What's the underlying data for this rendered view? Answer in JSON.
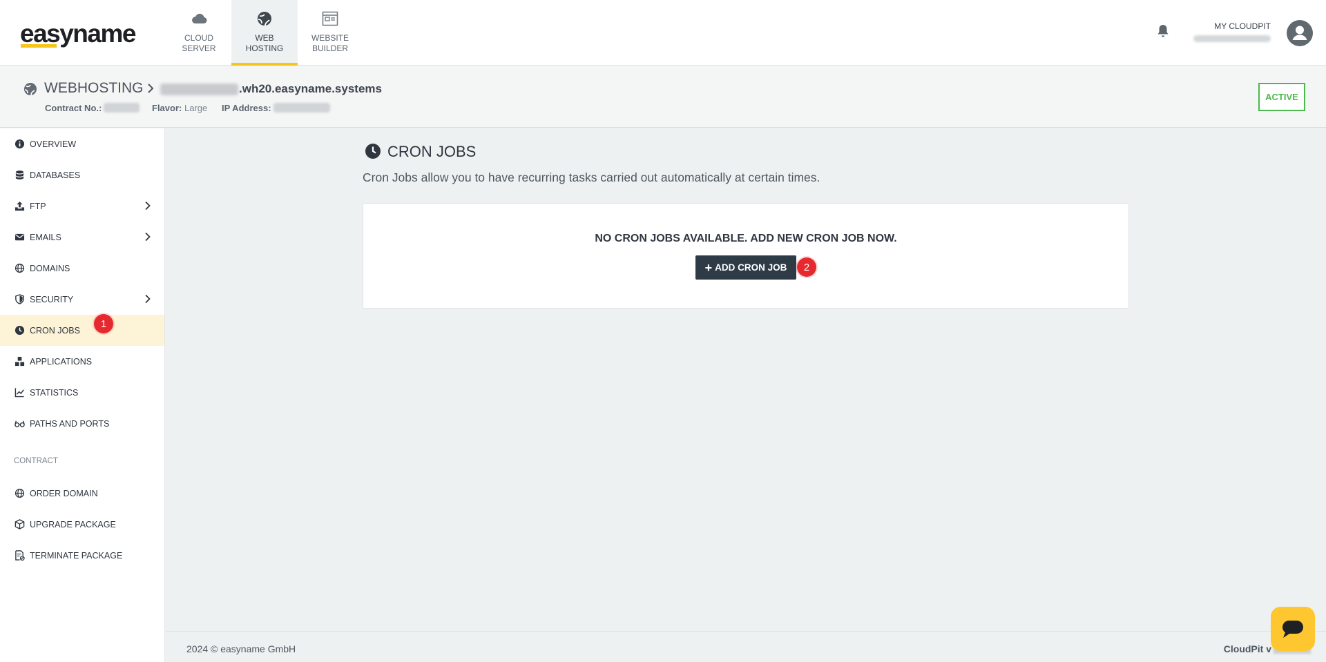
{
  "brand": {
    "logo_text": "easyname",
    "accent": "#f5c518"
  },
  "topnav": {
    "items": [
      {
        "line1": "CLOUD",
        "line2": "SERVER",
        "icon": "cloud-icon"
      },
      {
        "line1": "WEB",
        "line2": "HOSTING",
        "icon": "globe-icon",
        "active": true
      },
      {
        "line1": "WEBSITE",
        "line2": "BUILDER",
        "icon": "website-builder-icon"
      }
    ],
    "account_label": "MY CLOUDPIT"
  },
  "header": {
    "section": "WEBHOSTING",
    "host_suffix": ".wh20.easyname.systems",
    "contract_label": "Contract No.:",
    "flavor_label": "Flavor:",
    "flavor_value": "Large",
    "ip_label": "IP Address:",
    "status": "ACTIVE",
    "status_color": "#4cb94c"
  },
  "sidebar": {
    "items": [
      {
        "label": "OVERVIEW",
        "icon": "info-icon"
      },
      {
        "label": "DATABASES",
        "icon": "database-icon"
      },
      {
        "label": "FTP",
        "icon": "upload-icon",
        "chevron": true
      },
      {
        "label": "EMAILS",
        "icon": "envelope-icon",
        "chevron": true
      },
      {
        "label": "DOMAINS",
        "icon": "globe-icon"
      },
      {
        "label": "SECURITY",
        "icon": "shield-icon",
        "chevron": true
      },
      {
        "label": "CRON JOBS",
        "icon": "clock-icon",
        "active": true,
        "badge": "1"
      },
      {
        "label": "APPLICATIONS",
        "icon": "applications-icon"
      },
      {
        "label": "STATISTICS",
        "icon": "chart-line-icon"
      },
      {
        "label": "PATHS AND PORTS",
        "icon": "glasses-icon"
      }
    ],
    "contract_section": "CONTRACT",
    "contract_items": [
      {
        "label": "ORDER DOMAIN",
        "icon": "globe-icon"
      },
      {
        "label": "UPGRADE PACKAGE",
        "icon": "box-icon"
      },
      {
        "label": "TERMINATE PACKAGE",
        "icon": "document-cancel-icon"
      }
    ]
  },
  "main": {
    "title": "CRON JOBS",
    "description": "Cron Jobs allow you to have recurring tasks carried out automatically at certain times.",
    "empty_message": "NO CRON JOBS AVAILABLE. ADD NEW CRON JOB NOW.",
    "add_button": "ADD CRON JOB",
    "add_badge": "2"
  },
  "footer": {
    "copyright": "2024 © easyname GmbH",
    "version_label": "CloudPit v"
  }
}
